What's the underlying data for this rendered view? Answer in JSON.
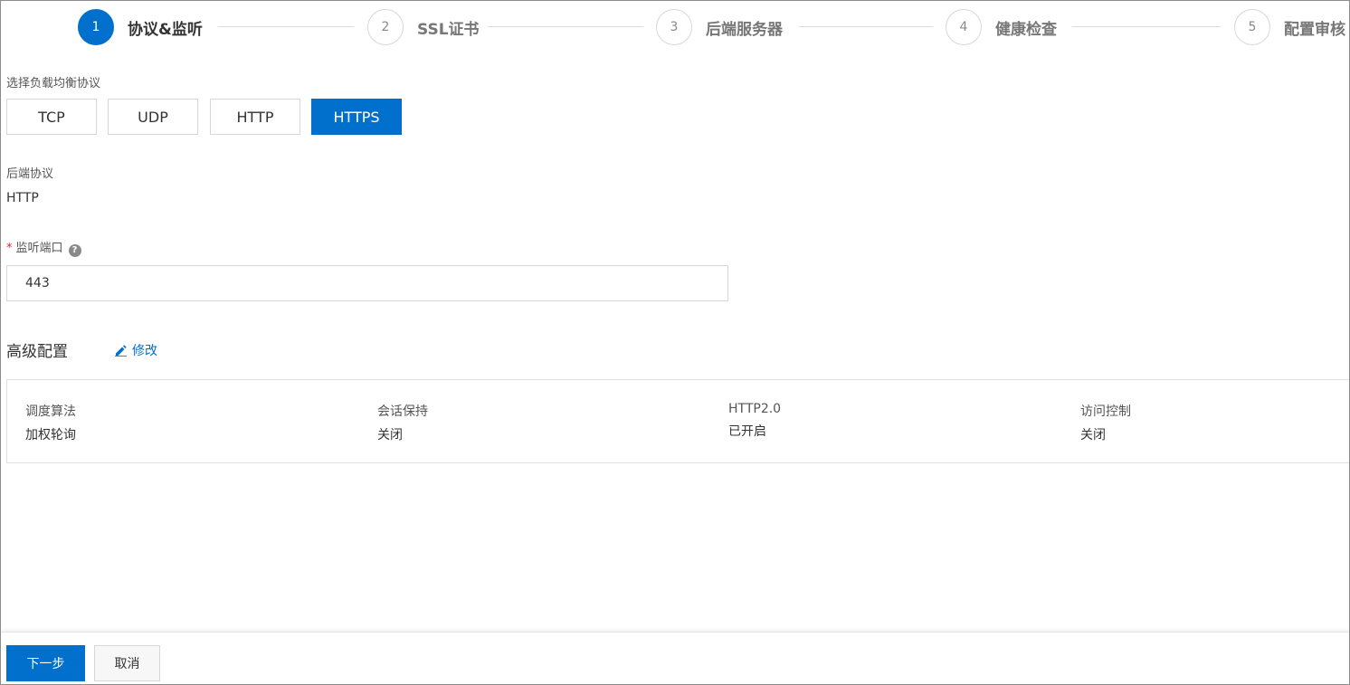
{
  "steps": [
    {
      "number": "1",
      "label": "协议&监听",
      "active": true
    },
    {
      "number": "2",
      "label": "SSL证书",
      "active": false
    },
    {
      "number": "3",
      "label": "后端服务器",
      "active": false
    },
    {
      "number": "4",
      "label": "健康检查",
      "active": false
    },
    {
      "number": "5",
      "label": "配置审核",
      "active": false
    }
  ],
  "protocol": {
    "label": "选择负载均衡协议",
    "options": [
      "TCP",
      "UDP",
      "HTTP",
      "HTTPS"
    ],
    "selected": "HTTPS"
  },
  "backend": {
    "label": "后端协议",
    "value": "HTTP"
  },
  "port": {
    "required_mark": "*",
    "label": "监听端口",
    "help_icon": "question-circle-icon",
    "value": "443"
  },
  "advanced": {
    "title": "高级配置",
    "edit_label": "修改",
    "edit_icon": "pencil-icon",
    "items": [
      {
        "key": "调度算法",
        "value": "加权轮询"
      },
      {
        "key": "会话保持",
        "value": "关闭"
      },
      {
        "key": "HTTP2.0",
        "value": "已开启"
      },
      {
        "key": "访问控制",
        "value": "关闭"
      }
    ]
  },
  "footer": {
    "next_label": "下一步",
    "cancel_label": "取消"
  },
  "colors": {
    "primary": "#0070cc",
    "border": "#d7d7d7",
    "required": "#e0282e"
  }
}
